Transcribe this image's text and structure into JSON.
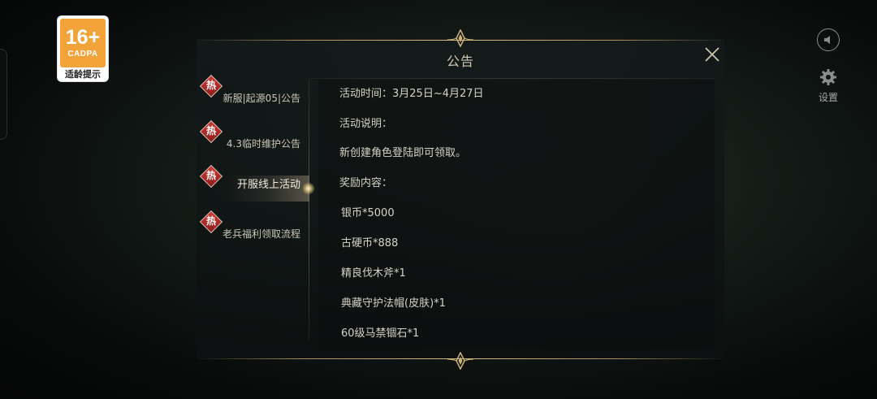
{
  "age_rating": {
    "number": "16+",
    "org": "CADPA",
    "label": "适龄提示"
  },
  "top_right": {
    "settings_label": "设置"
  },
  "dialog": {
    "title": "公告",
    "hot_badge": "热",
    "tabs": [
      {
        "label": "新服|起源05|公告",
        "active": false
      },
      {
        "label": "4.3临时维护公告",
        "active": false
      },
      {
        "label": "开服线上活动",
        "active": true
      },
      {
        "label": "老兵福利领取流程",
        "active": false
      }
    ],
    "content": [
      "活动时间：3月25日~4月27日",
      "活动说明：",
      "新创建角色登陆即可领取。",
      "奖励内容：",
      "银币*5000",
      "古硬币*888",
      "精良伐木斧*1",
      "典藏守护法帽(皮肤)*1",
      "60级马禁锢石*1"
    ]
  },
  "colors": {
    "accent_gold": "#d6bd84",
    "hot_red": "#c23330",
    "badge_orange": "#f2a33a"
  }
}
